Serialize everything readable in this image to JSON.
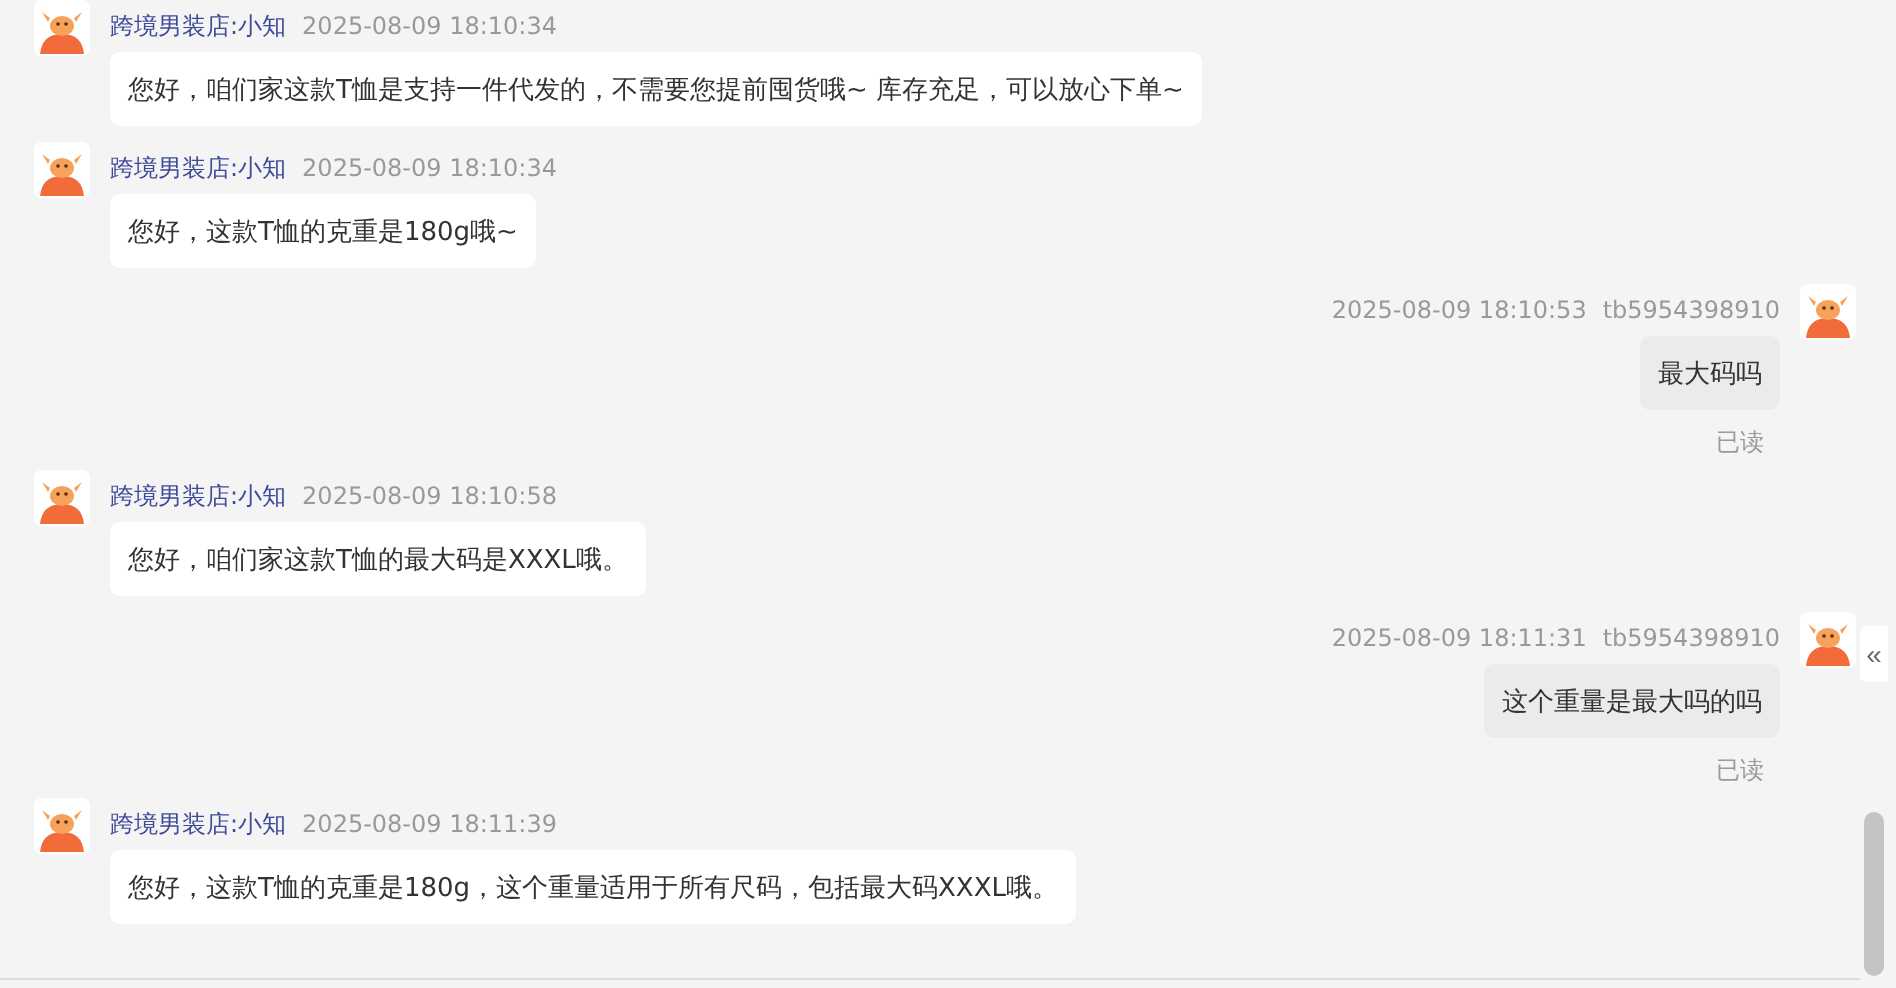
{
  "messages": [
    {
      "kind": "incoming",
      "sender": "跨境男装店:小知",
      "time": "2025-08-09 18:10:34",
      "text": "您好，咱们家这款T恤是支持一件代发的，不需要您提前囤货哦~ 库存充足，可以放心下单~"
    },
    {
      "kind": "incoming",
      "sender": "跨境男装店:小知",
      "time": "2025-08-09 18:10:34",
      "text": "您好，这款T恤的克重是180g哦~"
    },
    {
      "kind": "outgoing",
      "sender": "tb5954398910",
      "time": "2025-08-09 18:10:53",
      "text": "最大码吗",
      "status": "已读"
    },
    {
      "kind": "incoming",
      "sender": "跨境男装店:小知",
      "time": "2025-08-09 18:10:58",
      "text": "您好，咱们家这款T恤的最大码是XXXL哦。"
    },
    {
      "kind": "outgoing",
      "sender": "tb5954398910",
      "time": "2025-08-09 18:11:31",
      "text": "这个重量是最大吗的吗",
      "status": "已读"
    },
    {
      "kind": "incoming",
      "sender": "跨境男装店:小知",
      "time": "2025-08-09 18:11:39",
      "text": "您好，这款T恤的克重是180g，这个重量适用于所有尺码，包括最大码XXXL哦。"
    }
  ],
  "collapse_button": "«"
}
